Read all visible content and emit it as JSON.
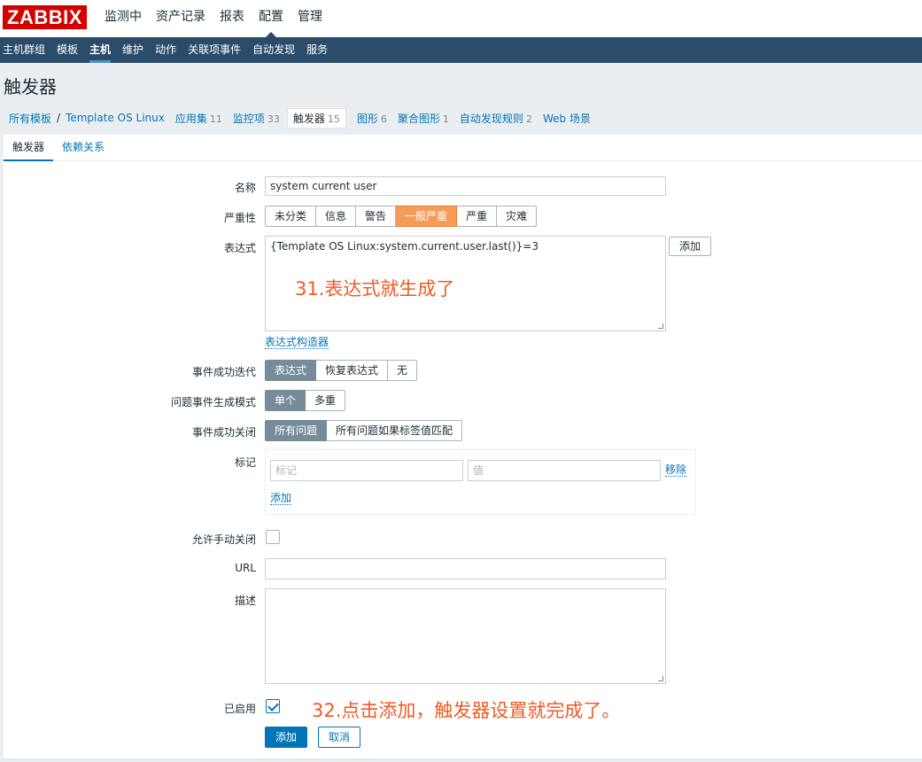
{
  "brand": {
    "logo_text": "ZABBIX",
    "color": "#d40000"
  },
  "main_menu": [
    {
      "label": "监测中",
      "active": false
    },
    {
      "label": "资产记录",
      "active": false
    },
    {
      "label": "报表",
      "active": false
    },
    {
      "label": "配置",
      "active": true
    },
    {
      "label": "管理",
      "active": false
    }
  ],
  "sub_menu": [
    {
      "label": "主机群组",
      "active": false
    },
    {
      "label": "模板",
      "active": false
    },
    {
      "label": "主机",
      "active": true
    },
    {
      "label": "维护",
      "active": false
    },
    {
      "label": "动作",
      "active": false
    },
    {
      "label": "关联项事件",
      "active": false
    },
    {
      "label": "自动发现",
      "active": false
    },
    {
      "label": "服务",
      "active": false
    }
  ],
  "page_title": "触发器",
  "breadcrumb": {
    "all_templates": "所有模板",
    "separator": "/",
    "template": "Template OS Linux",
    "items": [
      {
        "label": "应用集",
        "count": "11"
      },
      {
        "label": "监控项",
        "count": "33"
      },
      {
        "label": "触发器",
        "count": "15",
        "active": true
      },
      {
        "label": "图形",
        "count": "6"
      },
      {
        "label": "聚合图形",
        "count": "1"
      },
      {
        "label": "自动发现规则",
        "count": "2"
      },
      {
        "label": "Web 场景",
        "count": ""
      }
    ]
  },
  "form_tabs": [
    {
      "label": "触发器",
      "active": true
    },
    {
      "label": "依赖关系",
      "active": false
    }
  ],
  "form": {
    "name_label": "名称",
    "name_value": "system current user",
    "severity_label": "严重性",
    "severity_options": [
      "未分类",
      "信息",
      "警告",
      "一般严重",
      "严重",
      "灾难"
    ],
    "severity_selected": "一般严重",
    "expression_label": "表达式",
    "expression_value": "{Template OS Linux:system.current.user.last()}=3",
    "expression_add_button": "添加",
    "expression_builder_link": "表达式构造器",
    "ok_event_generation_label": "事件成功迭代",
    "ok_event_generation_options": [
      "表达式",
      "恢复表达式",
      "无"
    ],
    "ok_event_generation_selected": "表达式",
    "problem_mode_label": "问题事件生成模式",
    "problem_mode_options": [
      "单个",
      "多重"
    ],
    "problem_mode_selected": "单个",
    "ok_event_close_label": "事件成功关闭",
    "ok_event_close_options": [
      "所有问题",
      "所有问题如果标签值匹配"
    ],
    "ok_event_close_selected": "所有问题",
    "tags_label": "标记",
    "tag_placeholder": "标记",
    "value_placeholder": "值",
    "tag_remove_link": "移除",
    "tag_add_link": "添加",
    "manual_close_label": "允许手动关闭",
    "manual_close_checked": false,
    "url_label": "URL",
    "url_value": "",
    "description_label": "描述",
    "description_value": "",
    "enabled_label": "已启用",
    "enabled_checked": true,
    "submit_button": "添加",
    "cancel_button": "取消"
  },
  "annotations": {
    "step31": "31.表达式就生成了",
    "step32": "32.点击添加，触发器设置就完成了。",
    "color": "#f05a23"
  }
}
